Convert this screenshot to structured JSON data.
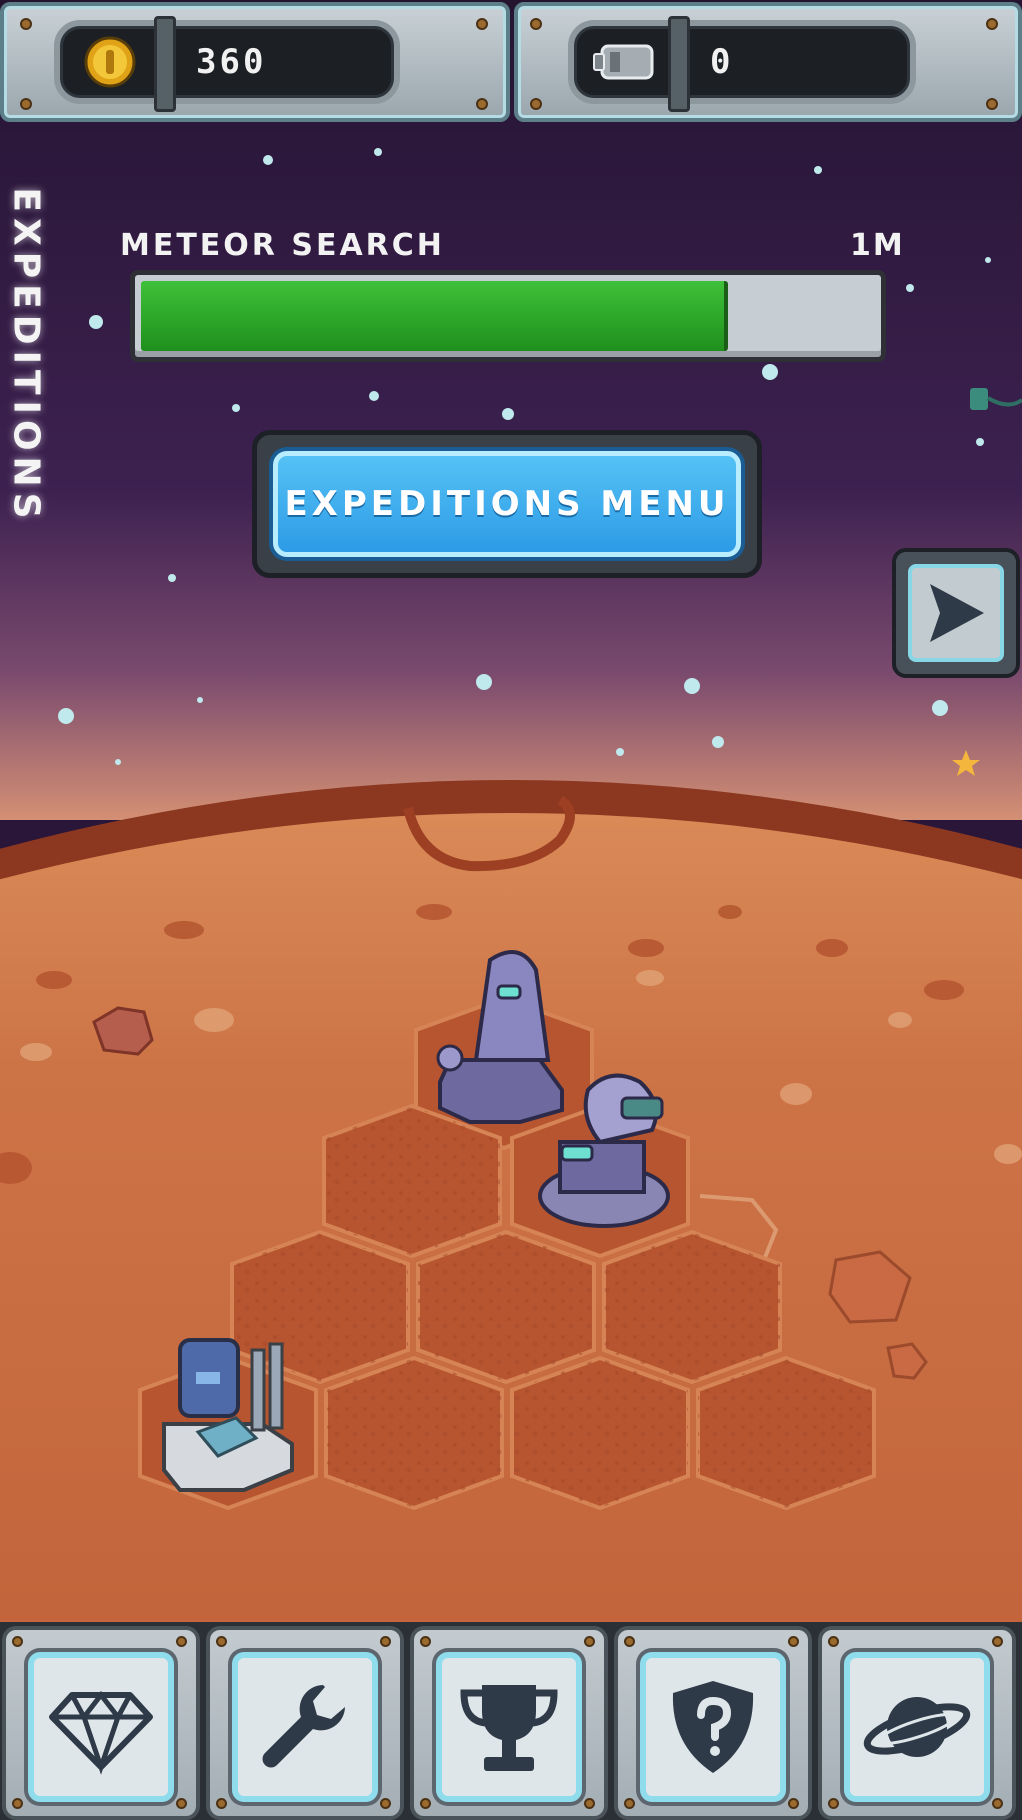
{
  "hud": {
    "coins": "360",
    "batteries": "0"
  },
  "side_tab": {
    "label": "EXPEDITIONS"
  },
  "expedition_progress": {
    "title": "METEOR SEARCH",
    "time_remaining": "1M",
    "progress_fraction": 0.8
  },
  "main": {
    "menu_button_label": "EXPEDITIONS MENU"
  },
  "toolbar": {
    "items": [
      {
        "icon": "diamond-icon"
      },
      {
        "icon": "wrench-icon"
      },
      {
        "icon": "trophy-icon"
      },
      {
        "icon": "shield-question-icon"
      },
      {
        "icon": "planet-icon"
      }
    ]
  },
  "colors": {
    "progress_fill": "#2ea92a",
    "menu_button": "#2d9be6",
    "mars_surface": "#c8693e",
    "space": "#2a1638"
  }
}
